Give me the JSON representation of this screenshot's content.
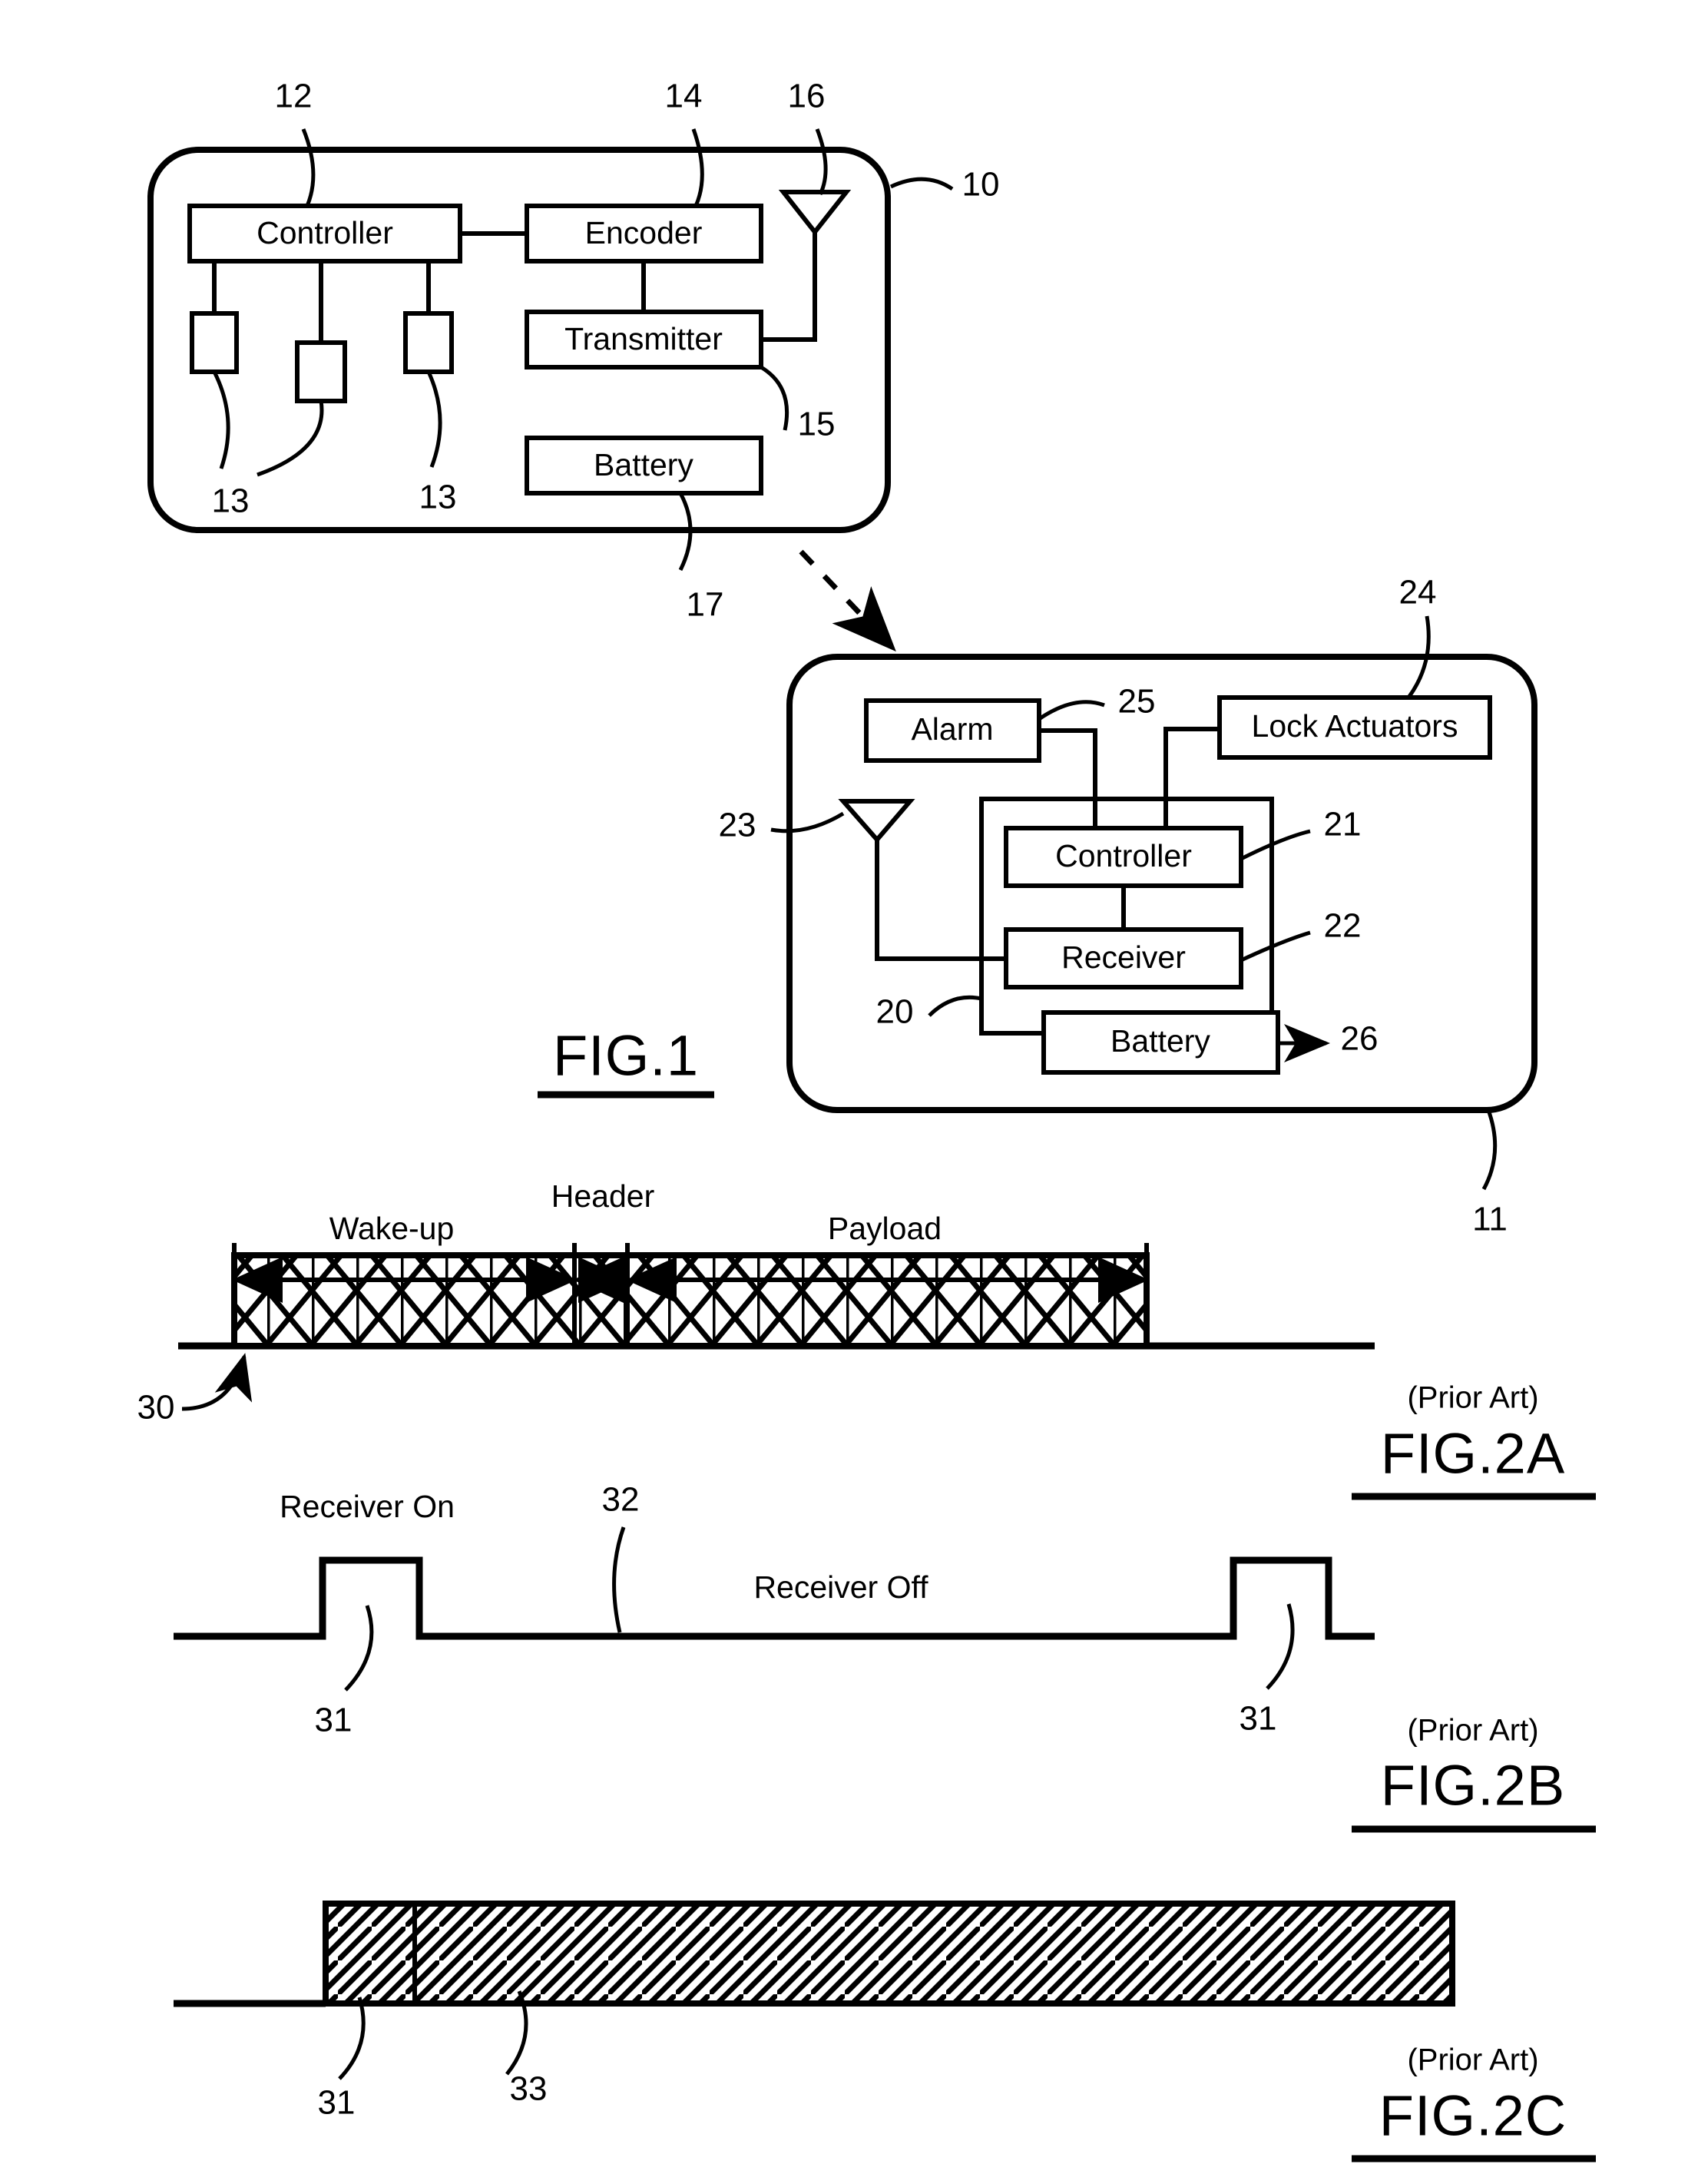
{
  "figure1": {
    "transmitter_unit": {
      "ref": "10",
      "blocks": [
        {
          "name": "controller",
          "label": "Controller",
          "ref": "12"
        },
        {
          "name": "encoder",
          "label": "Encoder",
          "ref": "14"
        },
        {
          "name": "transmitter",
          "label": "Transmitter",
          "ref": "15"
        },
        {
          "name": "battery",
          "label": "Battery",
          "ref": "17"
        }
      ],
      "antenna_ref": "16",
      "button_refs": [
        "13",
        "13"
      ]
    },
    "receiver_unit": {
      "ref": "11",
      "blocks": [
        {
          "name": "alarm",
          "label": "Alarm",
          "ref": "25"
        },
        {
          "name": "lock-actuators",
          "label": "Lock Actuators",
          "ref": "24"
        },
        {
          "name": "controller",
          "label": "Controller",
          "ref": "21"
        },
        {
          "name": "receiver",
          "label": "Receiver",
          "ref": "22"
        },
        {
          "name": "battery",
          "label": "Battery",
          "ref": "26"
        }
      ],
      "antenna_ref": "23",
      "module_ref": "20"
    },
    "caption": "FIG.1"
  },
  "figure2a": {
    "caption": "FIG.2A",
    "prior_art": "(Prior Art)",
    "signal_ref": "30",
    "segments": [
      {
        "name": "wake-up",
        "label": "Wake-up"
      },
      {
        "name": "header",
        "label": "Header"
      },
      {
        "name": "payload",
        "label": "Payload"
      }
    ]
  },
  "figure2b": {
    "caption": "FIG.2B",
    "prior_art": "(Prior Art)",
    "on_label": "Receiver On",
    "off_label": "Receiver Off",
    "pulse_refs": [
      "31",
      "31"
    ],
    "baseline_ref": "32"
  },
  "figure2c": {
    "caption": "FIG.2C",
    "prior_art": "(Prior Art)",
    "edge_ref": "31",
    "hatch_ref": "33"
  }
}
